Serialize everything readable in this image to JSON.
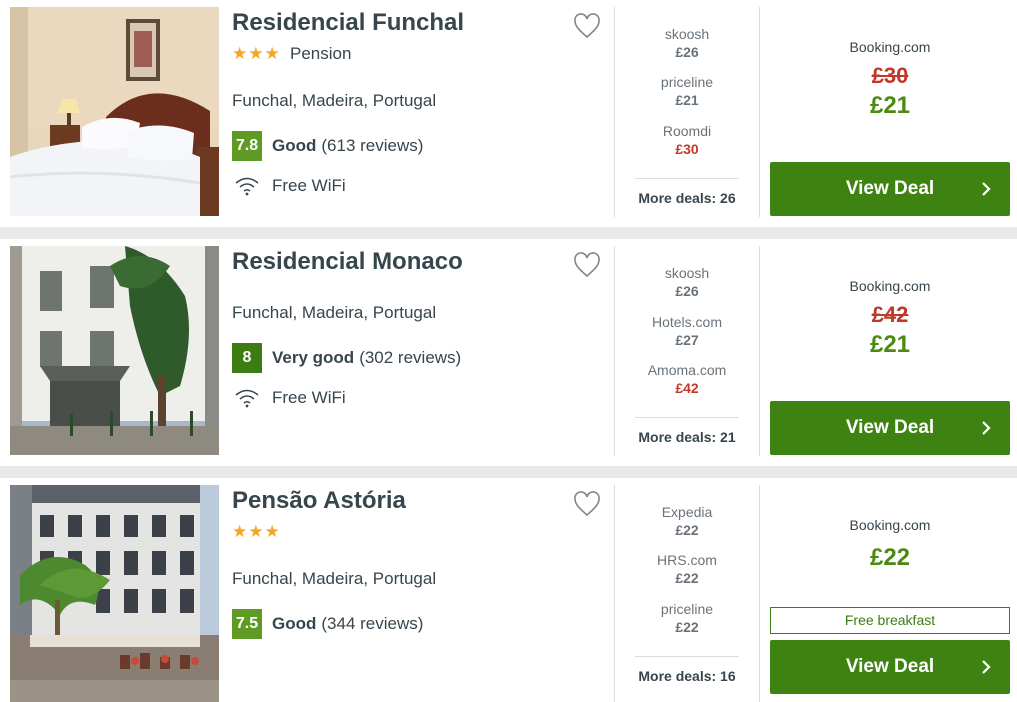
{
  "hotels": [
    {
      "name": "Residencial Funchal",
      "stars": "★★★",
      "type": "Pension",
      "location": "Funchal, Madeira, Portugal",
      "rating": {
        "score": "7.8",
        "label": "Good",
        "reviews": "(613 reviews)"
      },
      "amenity": "Free WiFi",
      "deals": [
        {
          "provider": "skoosh",
          "price": "£26"
        },
        {
          "provider": "priceline",
          "price": "£21"
        },
        {
          "provider": "Roomdi",
          "price": "£30"
        }
      ],
      "more_deals": "More deals: 26",
      "best": {
        "provider": "Booking.com",
        "old_price": "£30",
        "price": "£21"
      },
      "button": "View Deal"
    },
    {
      "name": "Residencial Monaco",
      "location": "Funchal, Madeira, Portugal",
      "rating": {
        "score": "8",
        "label": "Very good",
        "reviews": "(302 reviews)"
      },
      "amenity": "Free WiFi",
      "deals": [
        {
          "provider": "skoosh",
          "price": "£26"
        },
        {
          "provider": "Hotels.com",
          "price": "£27"
        },
        {
          "provider": "Amoma.com",
          "price": "£42"
        }
      ],
      "more_deals": "More deals: 21",
      "best": {
        "provider": "Booking.com",
        "old_price": "£42",
        "price": "£21"
      },
      "button": "View Deal"
    },
    {
      "name": "Pensão Astória",
      "stars": "★★★",
      "location": "Funchal, Madeira, Portugal",
      "rating": {
        "score": "7.5",
        "label": "Good",
        "reviews": "(344 reviews)"
      },
      "deals": [
        {
          "provider": "Expedia",
          "price": "£22"
        },
        {
          "provider": "HRS.com",
          "price": "£22"
        },
        {
          "provider": "priceline",
          "price": "£22"
        }
      ],
      "more_deals": "More deals: 16",
      "best": {
        "provider": "Booking.com",
        "price": "£22",
        "extra": "Free breakfast"
      },
      "button": "View Deal"
    }
  ],
  "colors": {
    "accent_green": "#3e8312",
    "price_green": "#4c8a12",
    "strike_red": "#c0392b",
    "star_orange": "#f5a623"
  }
}
